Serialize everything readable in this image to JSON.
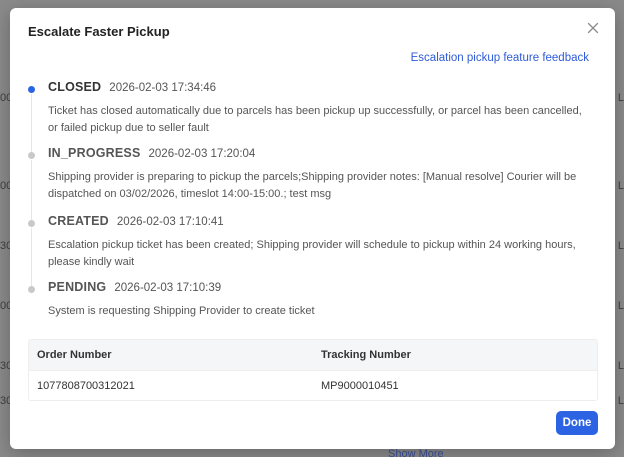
{
  "background": {
    "left_fragments": [
      "00",
      "00",
      "30",
      "00",
      "30",
      "30"
    ],
    "right_fragments": [
      "L",
      "L",
      "L",
      "L",
      "L",
      "L"
    ],
    "show_more": "Show More"
  },
  "modal": {
    "title": "Escalate Faster Pickup",
    "feedback_link": "Escalation pickup feature feedback",
    "timeline": [
      {
        "status": "CLOSED",
        "time": "2026-02-03 17:34:46",
        "active": true,
        "description": "Ticket has closed automatically due to parcels has been pickup up successfully, or parcel has been cancelled, or failed pickup due to seller fault"
      },
      {
        "status": "IN_PROGRESS",
        "time": "2026-02-03 17:20:04",
        "active": false,
        "description": "Shipping provider is preparing to pickup the parcels;Shipping provider notes: [Manual resolve] Courier will be dispatched on 03/02/2026, timeslot 14:00-15:00.; test msg"
      },
      {
        "status": "CREATED",
        "time": "2026-02-03 17:10:41",
        "active": false,
        "description": "Escalation pickup ticket has been created; Shipping provider will schedule to pickup within 24 working hours, please kindly wait"
      },
      {
        "status": "PENDING",
        "time": "2026-02-03 17:10:39",
        "active": false,
        "description": "System is requesting Shipping Provider to create ticket"
      }
    ],
    "table": {
      "headers": [
        "Order Number",
        "Tracking Number"
      ],
      "rows": [
        [
          "1077808700312021",
          "MP9000010451"
        ]
      ]
    },
    "done_label": "Done"
  },
  "colors": {
    "accent": "#2b63e3",
    "link": "#2e5bd8",
    "overlay": "#8a8a8a"
  },
  "icons": {
    "close": "close-icon"
  }
}
